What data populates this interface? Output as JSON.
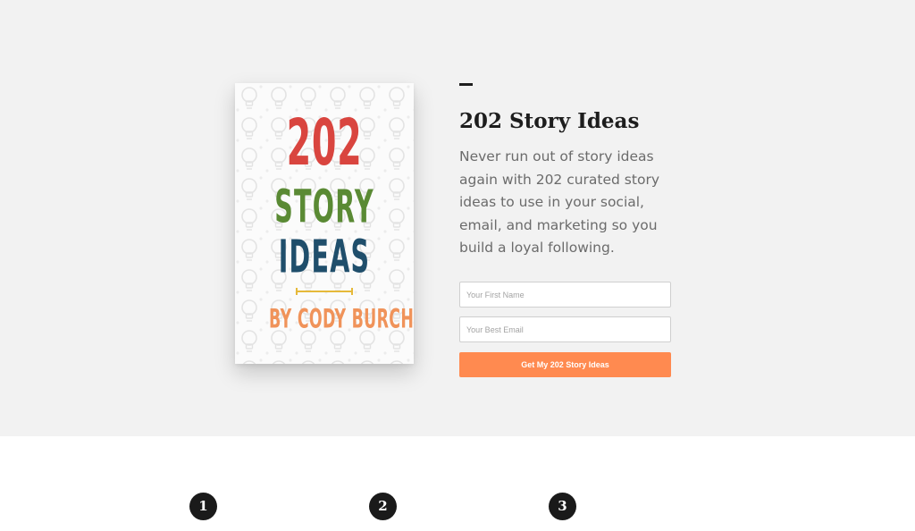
{
  "hero": {
    "book": {
      "number": "202",
      "line1": "STORY",
      "line2": "IDEAS",
      "author": "BY CODY BURCH",
      "colors": {
        "number": "#d9453f",
        "story": "#5a8a34",
        "ideas": "#1f4e6b",
        "rule": "#e6b93a",
        "author": "#f0935a"
      },
      "background_icon": "lightbulb-icon"
    },
    "title": "202 Story Ideas",
    "description": "Never run out of story ideas again with 202 curated story ideas to use in your social, email, and marketing so you build a loyal following.",
    "form": {
      "first_name_placeholder": "Your First Name",
      "first_name_value": "",
      "email_placeholder": "Your Best Email",
      "email_value": "",
      "submit_label": "Get My 202 Story Ideas"
    },
    "colors": {
      "background": "#f2f2f2",
      "cta": "#ff8a50"
    }
  },
  "steps": [
    {
      "number": "1"
    },
    {
      "number": "2"
    },
    {
      "number": "3"
    }
  ]
}
